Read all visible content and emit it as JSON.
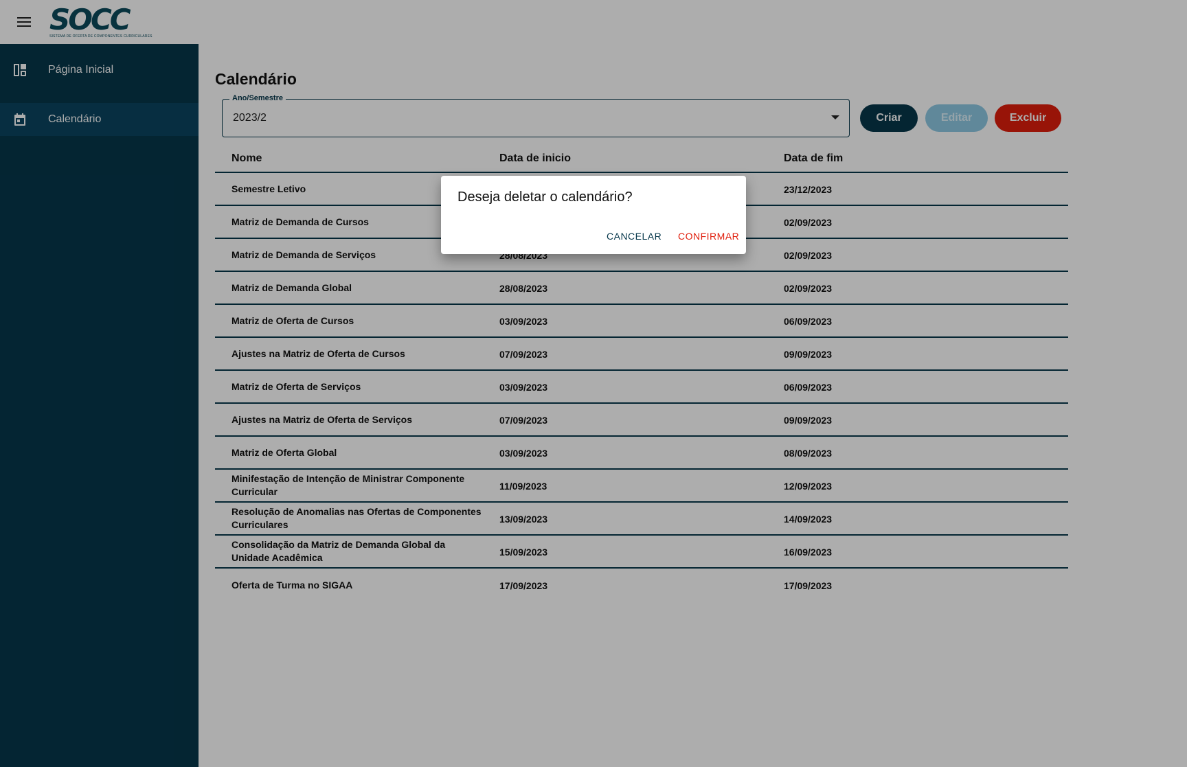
{
  "app": {
    "logo_text": "SOCC",
    "logo_subtitle": "SISTEMA DE OFERTA DE COMPONENTES CURRICULARES"
  },
  "sidebar": {
    "items": [
      {
        "label": "Página Inicial",
        "icon": "dashboard-icon"
      },
      {
        "label": "Calendário",
        "icon": "calendar-icon",
        "active": true
      }
    ]
  },
  "main": {
    "title": "Calendário",
    "select": {
      "label": "Ano/Semestre",
      "value": "2023/2"
    },
    "buttons": {
      "create": "Criar",
      "edit": "Editar",
      "delete": "Excluir"
    },
    "table": {
      "headers": [
        "Nome",
        "Data de inicio",
        "Data de fim"
      ],
      "rows": [
        {
          "name": "Semestre Letivo",
          "start": "",
          "end": "23/12/2023"
        },
        {
          "name": "Matriz de Demanda de Cursos",
          "start": "",
          "end": "02/09/2023"
        },
        {
          "name": "Matriz de Demanda de Serviços",
          "start": "28/08/2023",
          "end": "02/09/2023"
        },
        {
          "name": "Matriz de Demanda Global",
          "start": "28/08/2023",
          "end": "02/09/2023"
        },
        {
          "name": "Matriz de Oferta de Cursos",
          "start": "03/09/2023",
          "end": "06/09/2023"
        },
        {
          "name": "Ajustes na Matriz de Oferta de Cursos",
          "start": "07/09/2023",
          "end": "09/09/2023"
        },
        {
          "name": "Matriz de Oferta de Serviços",
          "start": "03/09/2023",
          "end": "06/09/2023"
        },
        {
          "name": " Ajustes na Matriz de Oferta de Serviços",
          "start": "07/09/2023",
          "end": "09/09/2023"
        },
        {
          "name": "Matriz de Oferta Global",
          "start": "03/09/2023",
          "end": "08/09/2023"
        },
        {
          "name": "Minifestação de Intenção de Ministrar Componente Curricular",
          "start": "11/09/2023",
          "end": "12/09/2023"
        },
        {
          "name": "Resolução de Anomalias nas Ofertas de Componentes Curriculares",
          "start": "13/09/2023",
          "end": "14/09/2023"
        },
        {
          "name": "Consolidação da Matriz de Demanda Global da Unidade Acadêmica",
          "start": "15/09/2023",
          "end": "16/09/2023"
        },
        {
          "name": "Oferta de Turma no SIGAA",
          "start": "17/09/2023",
          "end": "17/09/2023"
        }
      ]
    }
  },
  "dialog": {
    "title": "Deseja deletar o calendário?",
    "cancel": "CANCELAR",
    "confirm": "CONFIRMAR"
  },
  "colors": {
    "primary": "#06374b",
    "danger": "#e01e0c",
    "disabled": "#8ec9e4"
  }
}
